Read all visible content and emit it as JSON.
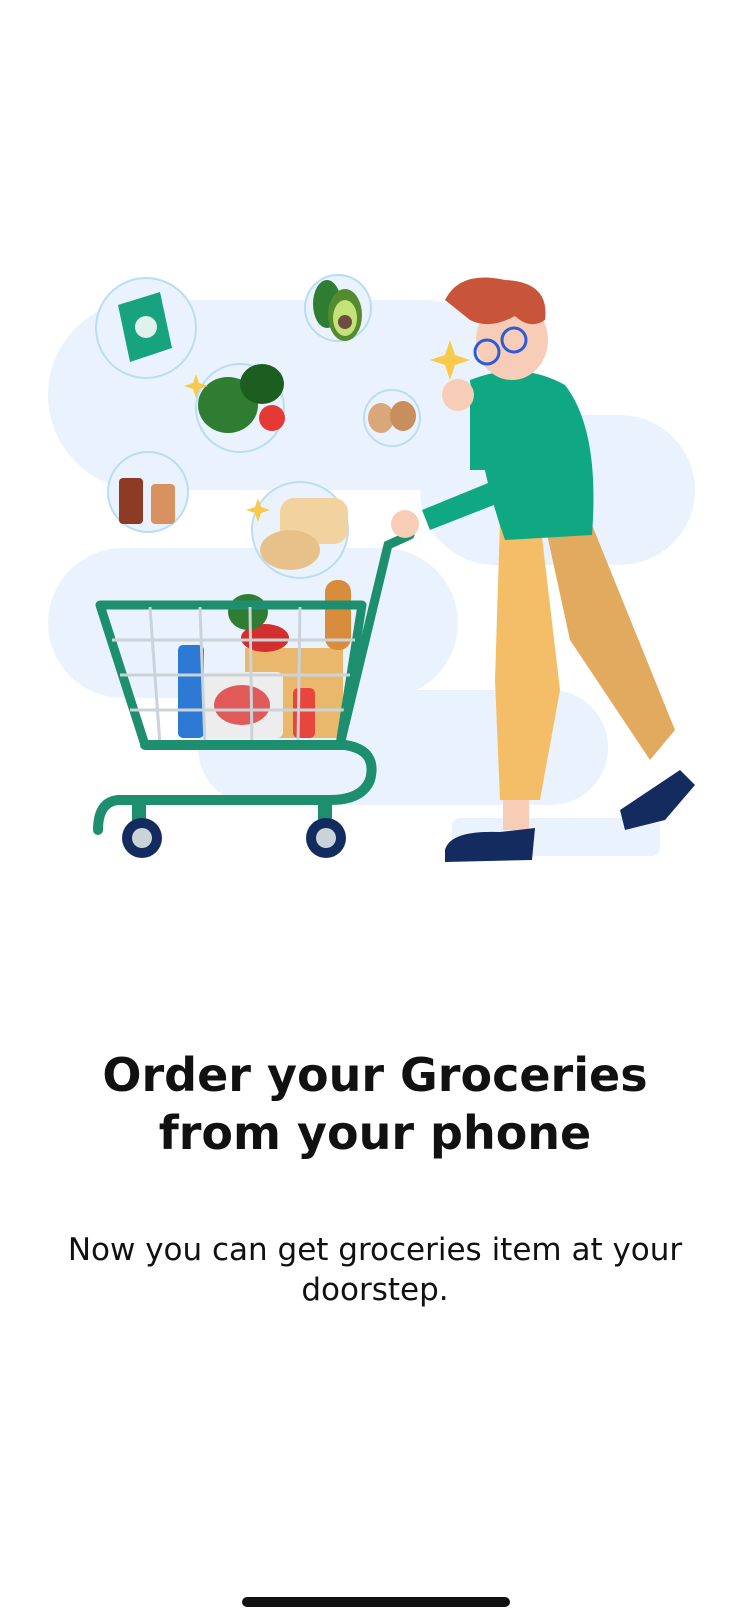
{
  "onboarding": {
    "illustration": {
      "alt_icon": "shopping-cart-illustration",
      "colors": {
        "blob": "#EAF3FD",
        "cart": "#1E8F6E",
        "sweater": "#0FA883",
        "pants": "#F4BE68",
        "hair": "#C8553A",
        "shoes": "#132B5E",
        "skin": "#F7CDB8"
      }
    },
    "title_line1": "Order your Groceries",
    "title_line2": "from your phone",
    "subtitle": "Now you can get groceries item at your doorstep."
  },
  "colors": {
    "background": "#FFFFFF",
    "text": "#111111",
    "home_indicator": "#111111"
  }
}
